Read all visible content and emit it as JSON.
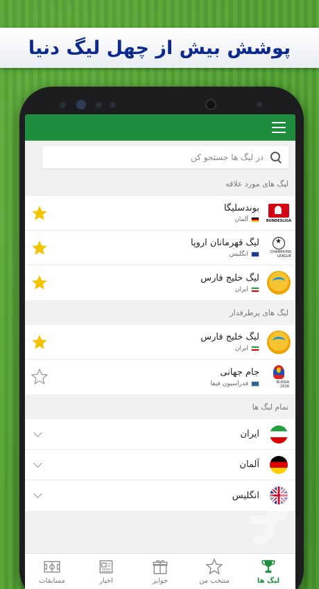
{
  "banner": {
    "title": "پوشش بیش از چهل لیگ دنیا"
  },
  "colors": {
    "accent": "#1e8e3e",
    "star": "#f5c400",
    "banner_text": "#0d2a8c"
  },
  "search": {
    "placeholder": "در لیگ ها جستجو کن",
    "value": ""
  },
  "sections": {
    "favorites": {
      "label": "لیگ های مورد علاقه"
    },
    "popular": {
      "label": "لیگ های پرطرفدار"
    },
    "all": {
      "label": "تمام لیگ ها"
    }
  },
  "favorites": [
    {
      "title": "بوندسلیگا",
      "country": "آلمان",
      "logo": "bundesliga-logo",
      "starred": true,
      "logo_text": "BUNDESLIGA"
    },
    {
      "title": "لیگ قهرمانان اروپا",
      "country": "انگلیس",
      "logo": "champions-league-logo",
      "starred": true,
      "logo_text": "CHAMPIONS LEAGUE"
    },
    {
      "title": "لیگ خلیج فارس",
      "country": "ایران",
      "logo": "persian-gulf-cup-logo",
      "starred": true
    }
  ],
  "popular": [
    {
      "title": "لیگ خلیج فارس",
      "country": "ایران",
      "logo": "persian-gulf-cup-logo",
      "starred": true
    },
    {
      "title": "جام جهانی",
      "country": "فدراسیون فیفا",
      "logo": "world-cup-logo",
      "starred": false,
      "logo_text": "RUSSIA 2018"
    }
  ],
  "countries": [
    {
      "name": "ایران",
      "flag": "iran-flag"
    },
    {
      "name": "آلمان",
      "flag": "germany-flag"
    },
    {
      "name": "انگلیس",
      "flag": "england-flag"
    }
  ],
  "bottom_nav": [
    {
      "label": "لیگ ها",
      "icon": "trophy-icon",
      "active": true
    },
    {
      "label": "منتخب من",
      "icon": "star-outline-icon",
      "active": false
    },
    {
      "label": "جوایز",
      "icon": "gift-icon",
      "active": false
    },
    {
      "label": "اخبار",
      "icon": "newspaper-icon",
      "active": false
    },
    {
      "label": "مسابقات",
      "icon": "field-icon",
      "active": false
    }
  ]
}
